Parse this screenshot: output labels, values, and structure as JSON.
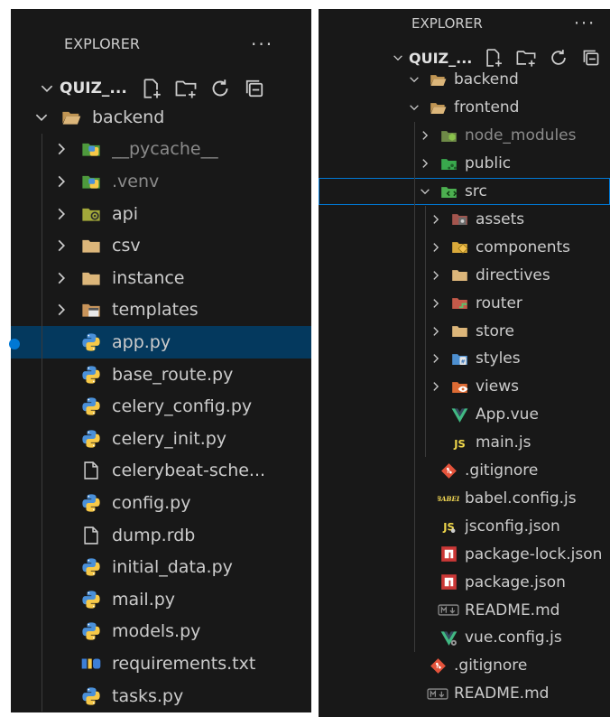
{
  "left": {
    "header": {
      "title": "EXPLORER",
      "more": "···",
      "root": "QUIZ_..."
    },
    "items": [
      {
        "depth": 1,
        "label": "backend",
        "kind": "folder",
        "expanded": true,
        "icon": "folder-open-icon"
      },
      {
        "depth": 2,
        "label": "__pycache__",
        "kind": "folder",
        "expanded": false,
        "dim": true,
        "icon": "python-folder-icon"
      },
      {
        "depth": 2,
        "label": ".venv",
        "kind": "folder",
        "expanded": false,
        "dim": true,
        "icon": "python-folder-icon"
      },
      {
        "depth": 2,
        "label": "api",
        "kind": "folder",
        "expanded": false,
        "icon": "api-folder-icon"
      },
      {
        "depth": 2,
        "label": "csv",
        "kind": "folder",
        "expanded": false,
        "icon": "folder-icon"
      },
      {
        "depth": 2,
        "label": "instance",
        "kind": "folder",
        "expanded": false,
        "icon": "folder-icon"
      },
      {
        "depth": 2,
        "label": "templates",
        "kind": "folder",
        "expanded": false,
        "icon": "templates-folder-icon"
      },
      {
        "depth": 2,
        "label": "app.py",
        "kind": "file",
        "selected": true,
        "icon": "python-icon"
      },
      {
        "depth": 2,
        "label": "base_route.py",
        "kind": "file",
        "icon": "python-icon"
      },
      {
        "depth": 2,
        "label": "celery_config.py",
        "kind": "file",
        "icon": "python-icon"
      },
      {
        "depth": 2,
        "label": "celery_init.py",
        "kind": "file",
        "icon": "python-icon"
      },
      {
        "depth": 2,
        "label": "celerybeat-sche...",
        "kind": "file",
        "icon": "file-icon"
      },
      {
        "depth": 2,
        "label": "config.py",
        "kind": "file",
        "icon": "python-icon"
      },
      {
        "depth": 2,
        "label": "dump.rdb",
        "kind": "file",
        "icon": "file-icon"
      },
      {
        "depth": 2,
        "label": "initial_data.py",
        "kind": "file",
        "icon": "python-icon"
      },
      {
        "depth": 2,
        "label": "mail.py",
        "kind": "file",
        "icon": "python-icon"
      },
      {
        "depth": 2,
        "label": "models.py",
        "kind": "file",
        "icon": "python-icon"
      },
      {
        "depth": 2,
        "label": "requirements.txt",
        "kind": "file",
        "icon": "pip-requirements-icon"
      },
      {
        "depth": 2,
        "label": "tasks.py",
        "kind": "file",
        "icon": "python-icon"
      }
    ]
  },
  "right": {
    "header": {
      "title": "EXPLORER",
      "more": "···",
      "root": "QUIZ_..."
    },
    "items": [
      {
        "depth": 1,
        "label": "backend",
        "kind": "folder",
        "expanded": true,
        "icon": "folder-open-icon"
      },
      {
        "depth": 1,
        "label": "frontend",
        "kind": "folder",
        "expanded": true,
        "icon": "folder-open-icon"
      },
      {
        "depth": 2,
        "label": "node_modules",
        "kind": "folder",
        "expanded": false,
        "dim": true,
        "icon": "node-folder-icon"
      },
      {
        "depth": 2,
        "label": "public",
        "kind": "folder",
        "expanded": false,
        "icon": "public-folder-icon"
      },
      {
        "depth": 2,
        "label": "src",
        "kind": "folder",
        "expanded": true,
        "focused": true,
        "icon": "src-folder-icon"
      },
      {
        "depth": 3,
        "label": "assets",
        "kind": "folder",
        "expanded": false,
        "icon": "assets-folder-icon"
      },
      {
        "depth": 3,
        "label": "components",
        "kind": "folder",
        "expanded": false,
        "icon": "components-folder-icon"
      },
      {
        "depth": 3,
        "label": "directives",
        "kind": "folder",
        "expanded": false,
        "icon": "folder-icon"
      },
      {
        "depth": 3,
        "label": "router",
        "kind": "folder",
        "expanded": false,
        "icon": "router-folder-icon"
      },
      {
        "depth": 3,
        "label": "store",
        "kind": "folder",
        "expanded": false,
        "icon": "folder-icon"
      },
      {
        "depth": 3,
        "label": "styles",
        "kind": "folder",
        "expanded": false,
        "icon": "styles-folder-icon"
      },
      {
        "depth": 3,
        "label": "views",
        "kind": "folder",
        "expanded": false,
        "icon": "views-folder-icon"
      },
      {
        "depth": 3,
        "label": "App.vue",
        "kind": "file",
        "icon": "vue-icon"
      },
      {
        "depth": 3,
        "label": "main.js",
        "kind": "file",
        "icon": "javascript-icon"
      },
      {
        "depth": 2,
        "label": ".gitignore",
        "kind": "file",
        "icon": "git-icon"
      },
      {
        "depth": 2,
        "label": "babel.config.js",
        "kind": "file",
        "icon": "babel-icon"
      },
      {
        "depth": 2,
        "label": "jsconfig.json",
        "kind": "file",
        "icon": "jsconfig-icon"
      },
      {
        "depth": 2,
        "label": "package-lock.json",
        "kind": "file",
        "icon": "npm-icon"
      },
      {
        "depth": 2,
        "label": "package.json",
        "kind": "file",
        "icon": "npm-icon"
      },
      {
        "depth": 2,
        "label": "README.md",
        "kind": "file",
        "icon": "markdown-icon"
      },
      {
        "depth": 2,
        "label": "vue.config.js",
        "kind": "file",
        "icon": "vue-config-icon"
      },
      {
        "depth": 1,
        "label": ".gitignore",
        "kind": "file",
        "icon": "git-icon"
      },
      {
        "depth": 1,
        "label": "README.md",
        "kind": "file",
        "icon": "markdown-icon"
      }
    ]
  },
  "colors": {
    "background": "#181818",
    "text": "#cccccc",
    "dimText": "#8b8b8b",
    "selection": "#04395e",
    "focusBorder": "#0078d4",
    "folder": "#dcb67a"
  }
}
